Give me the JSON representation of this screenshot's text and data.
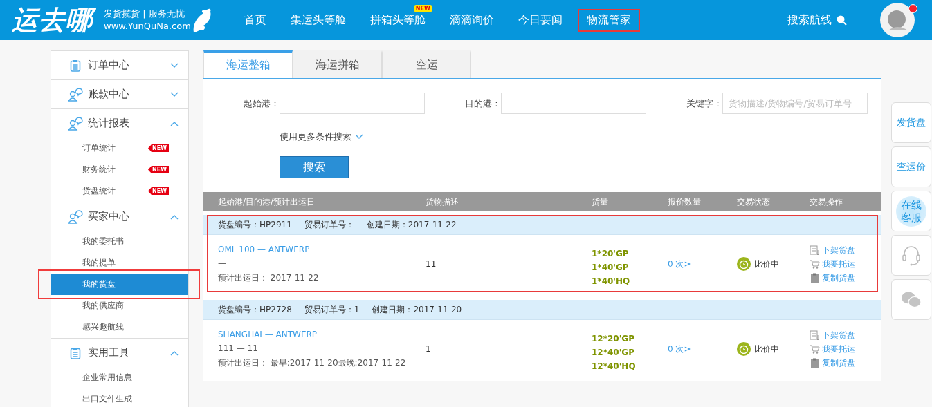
{
  "header": {
    "logo": "运去哪",
    "slogan": "发货揽货 | 服务无忧",
    "site": "www.YunQuNa.com",
    "nav": [
      {
        "label": "首页",
        "highlighted": false
      },
      {
        "label": "集运头等舱",
        "highlighted": false
      },
      {
        "label": "拼箱头等舱",
        "badge": "NEW",
        "highlighted": false
      },
      {
        "label": "滴滴询价",
        "highlighted": false
      },
      {
        "label": "今日要闻",
        "highlighted": false
      },
      {
        "label": "物流管家",
        "highlighted": true
      }
    ],
    "search_label": "搜索航线",
    "notification": true
  },
  "sidebar": [
    {
      "label": "订单中心",
      "expanded": false
    },
    {
      "label": "账款中心",
      "expanded": false
    },
    {
      "label": "统计报表",
      "expanded": true,
      "children": [
        {
          "label": "订单统计",
          "badge": "NEW",
          "selected": false,
          "highlighted": false
        },
        {
          "label": "财务统计",
          "badge": "NEW",
          "selected": false,
          "highlighted": false
        },
        {
          "label": "货盘统计",
          "badge": "NEW",
          "selected": false,
          "highlighted": false
        }
      ]
    },
    {
      "label": "买家中心",
      "expanded": true,
      "children": [
        {
          "label": "我的委托书",
          "selected": false,
          "highlighted": false
        },
        {
          "label": "我的提单",
          "selected": false,
          "highlighted": false
        },
        {
          "label": "我的货盘",
          "selected": true,
          "highlighted": true
        },
        {
          "label": "我的供应商",
          "selected": false,
          "highlighted": false
        },
        {
          "label": "感兴趣航线",
          "selected": false,
          "highlighted": false
        }
      ]
    },
    {
      "label": "实用工具",
      "expanded": true,
      "children": [
        {
          "label": "企业常用信息",
          "selected": false,
          "highlighted": false
        },
        {
          "label": "出口文件生成",
          "selected": false,
          "highlighted": false
        }
      ]
    }
  ],
  "tabs": [
    {
      "label": "海运整箱",
      "selected": true
    },
    {
      "label": "海运拼箱",
      "selected": false
    },
    {
      "label": "空运",
      "selected": false
    }
  ],
  "search": {
    "fields": [
      {
        "label": "起始港："
      },
      {
        "label": "目的港："
      },
      {
        "label": "关键字：",
        "placeholder": "货物描述/货物编号/贸易订单号"
      }
    ],
    "more": "使用更多条件搜索",
    "button": "搜索"
  },
  "table": {
    "columns": [
      "起始港/目的港/预计出运日",
      "货物描述",
      "货量",
      "报价数量",
      "交易状态",
      "交易操作"
    ],
    "orders": [
      {
        "cargo_no": "货盘编号：HP2911",
        "trade_no": "贸易订单号：",
        "created": "创建日期：2017-11-22",
        "route": "OML 100 — ANTWERP",
        "detail": "—",
        "etd": "预计出运日： 2017-11-22",
        "description": "11",
        "quantities": [
          "1*20'GP",
          "1*40'GP",
          "1*40'HQ"
        ],
        "quotes": "0 次>",
        "status": "比价中",
        "actions": [
          {
            "kind": "unlist",
            "label": "下架货盘"
          },
          {
            "kind": "ship",
            "label": "我要托运"
          },
          {
            "kind": "copy",
            "label": "复制货盘"
          }
        ],
        "highlighted": true
      },
      {
        "cargo_no": "货盘编号：HP2728",
        "trade_no": "贸易订单号：1",
        "created": "创建日期：2017-11-20",
        "route": "SHANGHAI — ANTWERP",
        "detail": "111 — 11",
        "etd": "预计出运日： 最早:2017-11-20最晚:2017-11-22",
        "description": "1",
        "quantities": [
          "12*20'GP",
          "12*40'GP",
          "12*40'HQ"
        ],
        "quotes": "0 次>",
        "status": "比价中",
        "actions": [
          {
            "kind": "unlist",
            "label": "下架货盘"
          },
          {
            "kind": "ship",
            "label": "我要托运"
          },
          {
            "kind": "copy",
            "label": "复制货盘"
          }
        ],
        "highlighted": false
      }
    ]
  },
  "float_bar": [
    {
      "kind": "text",
      "label": "发货盘"
    },
    {
      "kind": "text",
      "label": "查运价"
    },
    {
      "kind": "service",
      "label": "在线客服"
    },
    {
      "kind": "headset"
    },
    {
      "kind": "wechat"
    }
  ]
}
